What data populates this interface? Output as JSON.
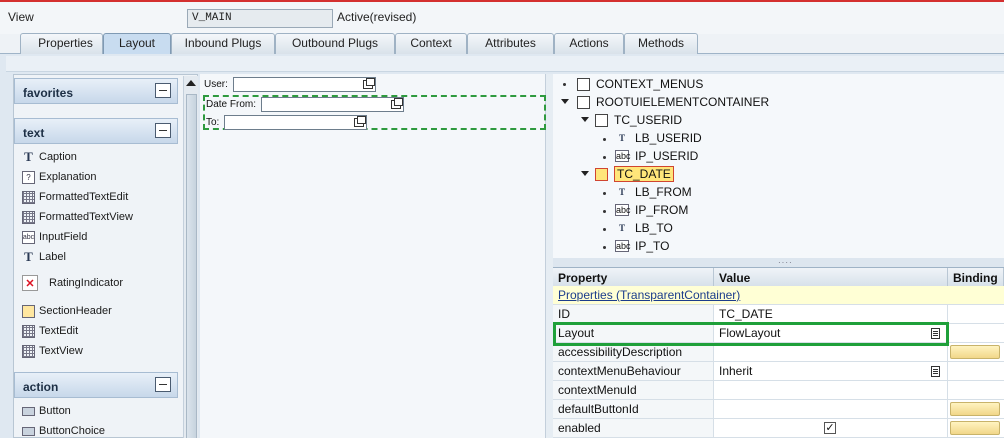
{
  "header": {
    "view_label": "View",
    "view_name": "V_MAIN",
    "status": "Active(revised)"
  },
  "tabs": [
    {
      "label": "Properties",
      "active": false
    },
    {
      "label": "Layout",
      "active": true
    },
    {
      "label": "Inbound Plugs",
      "active": false
    },
    {
      "label": "Outbound Plugs",
      "active": false
    },
    {
      "label": "Context",
      "active": false
    },
    {
      "label": "Attributes",
      "active": false
    },
    {
      "label": "Actions",
      "active": false
    },
    {
      "label": "Methods",
      "active": false
    }
  ],
  "palette": {
    "favorites": "favorites",
    "text_group": "text",
    "action_group": "action",
    "text_items": [
      "Caption",
      "Explanation",
      "FormattedTextEdit",
      "FormattedTextView",
      "InputField",
      "Label",
      "RatingIndicator",
      "SectionHeader",
      "TextEdit",
      "TextView"
    ],
    "action_items": [
      "Button",
      "ButtonChoice"
    ]
  },
  "canvas": {
    "user_label": "User:",
    "date_from_label": "Date From:",
    "to_label": "To:"
  },
  "hierarchy": [
    {
      "name": "CONTEXT_MENUS",
      "type": "container"
    },
    {
      "name": "ROOTUIELEMENTCONTAINER",
      "type": "container"
    },
    {
      "name": "TC_USERID",
      "type": "container"
    },
    {
      "name": "LB_USERID",
      "type": "label"
    },
    {
      "name": "IP_USERID",
      "type": "input"
    },
    {
      "name": "TC_DATE",
      "type": "container",
      "selected": true
    },
    {
      "name": "LB_FROM",
      "type": "label"
    },
    {
      "name": "IP_FROM",
      "type": "input"
    },
    {
      "name": "LB_TO",
      "type": "label"
    },
    {
      "name": "IP_TO",
      "type": "input"
    }
  ],
  "properties": {
    "col_property": "Property",
    "col_value": "Value",
    "col_binding": "Binding",
    "section": "Properties (TransparentContainer)",
    "rows": [
      {
        "name": "ID",
        "value": "TC_DATE"
      },
      {
        "name": "Layout",
        "value": "FlowLayout"
      },
      {
        "name": "accessibilityDescription",
        "value": ""
      },
      {
        "name": "contextMenuBehaviour",
        "value": "Inherit"
      },
      {
        "name": "contextMenuId",
        "value": ""
      },
      {
        "name": "defaultButtonId",
        "value": ""
      },
      {
        "name": "enabled",
        "value": "✓"
      }
    ]
  },
  "colors": {
    "highlight_green": "#1fa03a",
    "selected_node": "#ffe67a",
    "binding_button": "#f1d78a"
  }
}
